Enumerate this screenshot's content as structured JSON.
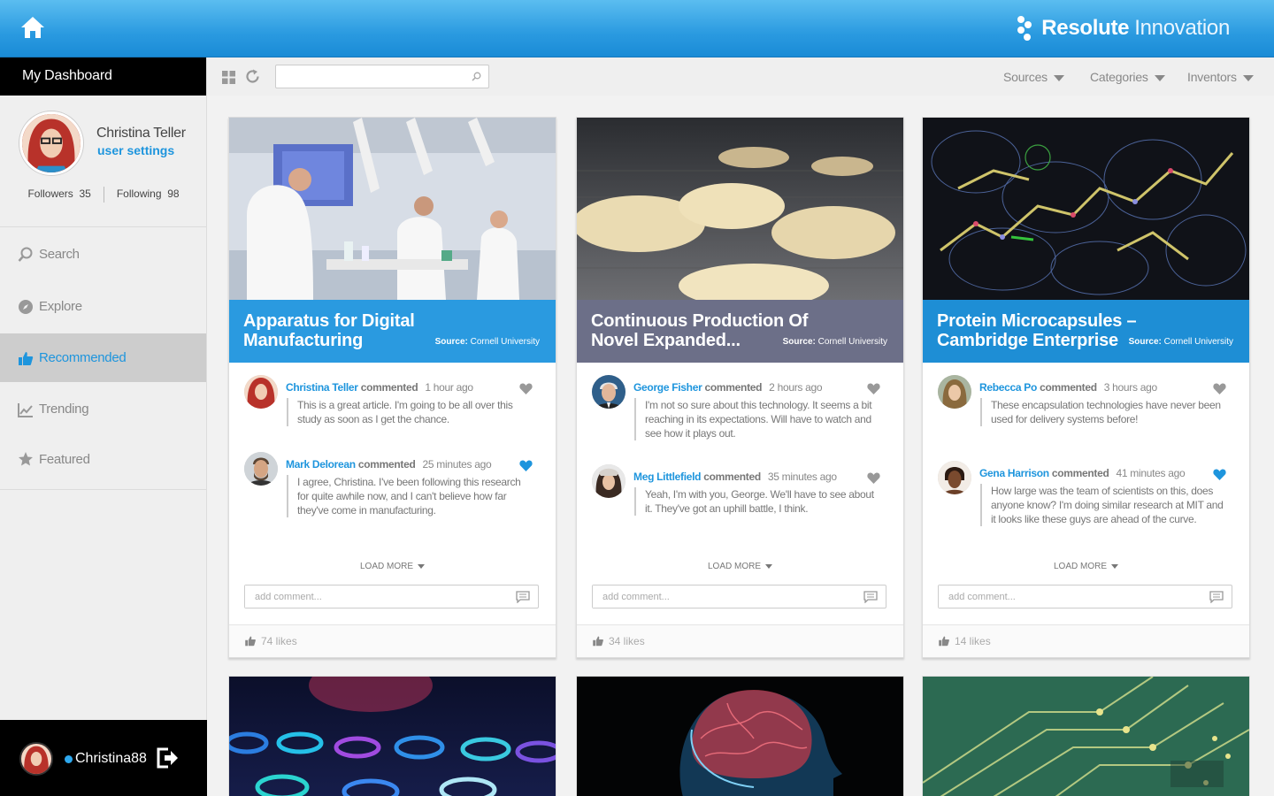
{
  "app": {
    "brand_bold": "Resolute",
    "brand_light": "Innovation"
  },
  "sidebar": {
    "dashboard_label": "My Dashboard",
    "profile": {
      "name": "Christina Teller",
      "settings_link": "user settings",
      "followers_label": "Followers",
      "followers": "35",
      "following_label": "Following",
      "following": "98"
    },
    "items": [
      {
        "label": "Search",
        "icon": "search-icon",
        "active": false
      },
      {
        "label": "Explore",
        "icon": "compass-icon",
        "active": false
      },
      {
        "label": "Recommended",
        "icon": "thumbs-up-icon",
        "active": true
      },
      {
        "label": "Trending",
        "icon": "trend-chart-icon",
        "active": false
      },
      {
        "label": "Featured",
        "icon": "star-icon",
        "active": false
      }
    ],
    "user": {
      "username": "Christina88",
      "status": "online"
    }
  },
  "toolbar": {
    "search": {
      "value": "",
      "placeholder": ""
    },
    "filters": [
      "Sources",
      "Categories",
      "Inventors"
    ]
  },
  "cards": [
    {
      "title": "Apparatus for Digital Manufacturing",
      "source_label": "Source:",
      "source": "Cornell University",
      "title_bg": "#2a9ae0",
      "comments": [
        {
          "name": "Christina Teller",
          "verb": "commented",
          "time": "1 hour ago",
          "liked": false,
          "text": "This is a great article.  I'm going to be all over this study as soon as I get the chance."
        },
        {
          "name": "Mark Delorean",
          "verb": "commented",
          "time": "25 minutes ago",
          "liked": true,
          "text": "I agree, Christina.  I've been following this research for quite awhile now, and I can't believe how far they've come in manufacturing."
        }
      ],
      "load_more": "LOAD MORE",
      "add_comment_placeholder": "add comment...",
      "likes": "74 likes"
    },
    {
      "title": "Continuous Production Of Novel Expanded...",
      "source_label": "Source:",
      "source": "Cornell University",
      "title_bg": "#6c6f88",
      "comments": [
        {
          "name": "George Fisher",
          "verb": "commented",
          "time": "2 hours ago",
          "liked": false,
          "text": "I'm not so sure about this technology.  It seems a bit reaching in its expectations.  Will have to watch and see how it plays out."
        },
        {
          "name": "Meg Littlefield",
          "verb": "commented",
          "time": "35 minutes ago",
          "liked": false,
          "text": "Yeah, I'm with you, George.  We'll have to see about it.  They've got an uphill battle, I think."
        }
      ],
      "load_more": "LOAD MORE",
      "add_comment_placeholder": "add comment...",
      "likes": "34 likes"
    },
    {
      "title": "Protein Microcapsules – Cambridge Enterprise",
      "source_label": "Source:",
      "source": "Cornell University",
      "title_bg": "#1e8ed5",
      "comments": [
        {
          "name": "Rebecca Po",
          "verb": "commented",
          "time": "3 hours ago",
          "liked": false,
          "text": "These encapsulation technologies have never been used for delivery systems before!"
        },
        {
          "name": "Gena Harrison",
          "verb": "commented",
          "time": "41 minutes ago",
          "liked": true,
          "text": "How large was the team of scientists on this, does anyone know?  I'm doing similar research at MIT and it looks like these guys are ahead of the curve."
        }
      ],
      "load_more": "LOAD MORE",
      "add_comment_placeholder": "add comment...",
      "likes": "14 likes"
    }
  ],
  "colors": {
    "accent": "#1e95dd",
    "header": "#2a9ae0",
    "heart_liked": "#1e95dd",
    "heart_default": "#999999"
  }
}
